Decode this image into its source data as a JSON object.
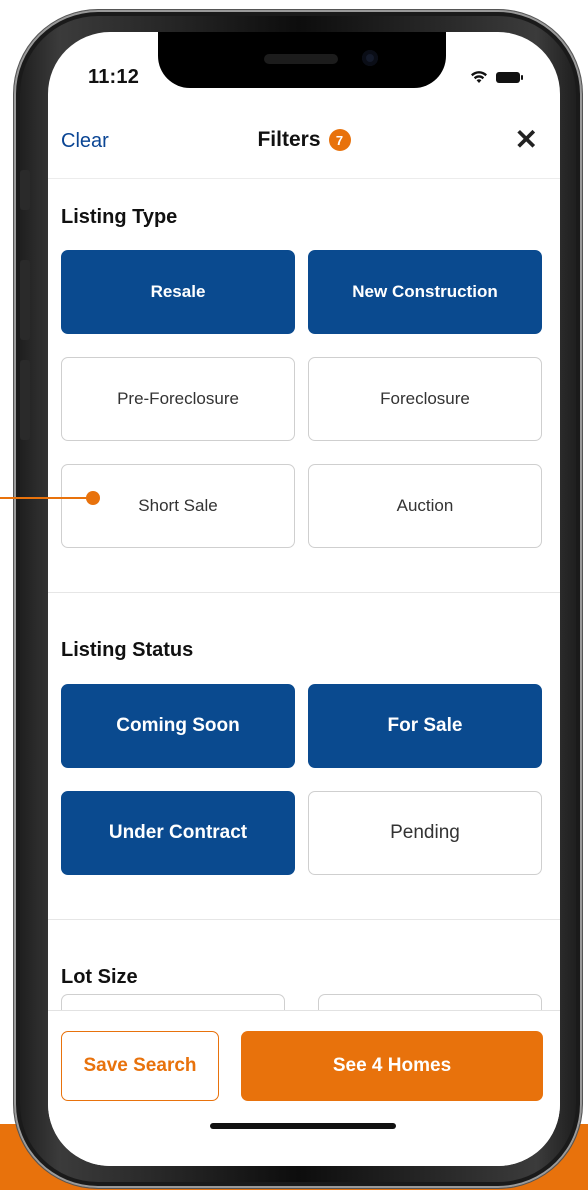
{
  "status_bar": {
    "time": "11:12"
  },
  "header": {
    "clear_label": "Clear",
    "title": "Filters",
    "active_count": "7",
    "close_symbol": "✕"
  },
  "listing_type": {
    "title": "Listing Type",
    "options": [
      {
        "label": "Resale",
        "selected": true
      },
      {
        "label": "New Construction",
        "selected": true
      },
      {
        "label": "Pre-Foreclosure",
        "selected": false
      },
      {
        "label": "Foreclosure",
        "selected": false
      },
      {
        "label": "Short Sale",
        "selected": false
      },
      {
        "label": "Auction",
        "selected": false
      }
    ]
  },
  "listing_status": {
    "title": "Listing Status",
    "options": [
      {
        "label": "Coming Soon",
        "selected": true
      },
      {
        "label": "For Sale",
        "selected": true
      },
      {
        "label": "Under Contract",
        "selected": true
      },
      {
        "label": "Pending",
        "selected": false
      }
    ]
  },
  "lot_size": {
    "title": "Lot Size"
  },
  "footer": {
    "save_label": "Save Search",
    "see_label": "See 4 Homes"
  },
  "colors": {
    "accent": "#e8720c",
    "selected_fill": "#0a4a8f",
    "link": "#0a4594"
  }
}
